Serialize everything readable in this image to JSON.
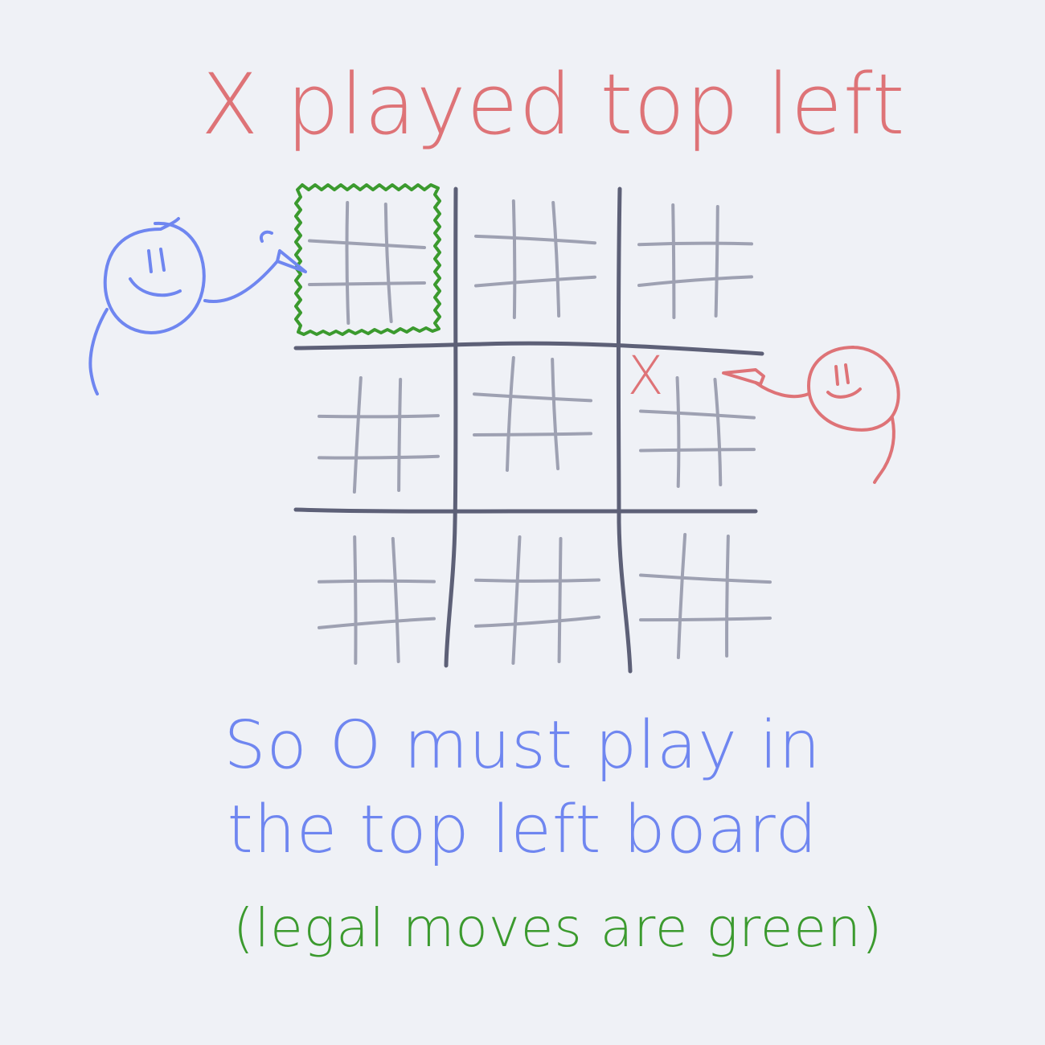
{
  "colors": {
    "background": "#eff1f6",
    "x_player": "#de7377",
    "o_player": "#6f86f0",
    "legal": "#3b9a2e",
    "major_grid": "#5d6077",
    "minor_grid": "#9ea1b2"
  },
  "title": "X played top left",
  "caption": {
    "line1": "So O must play in",
    "line2": "the top left board",
    "note": "(legal moves are green)"
  },
  "board": {
    "x_mark": "X",
    "last_move": {
      "board_row": 1,
      "board_col": 2,
      "cell_row": 0,
      "cell_col": 0
    },
    "legal_board": {
      "row": 0,
      "col": 0
    }
  },
  "icons": {
    "o_player": "stick-figure-with-pen-icon",
    "x_player": "stick-figure-with-pen-icon"
  }
}
